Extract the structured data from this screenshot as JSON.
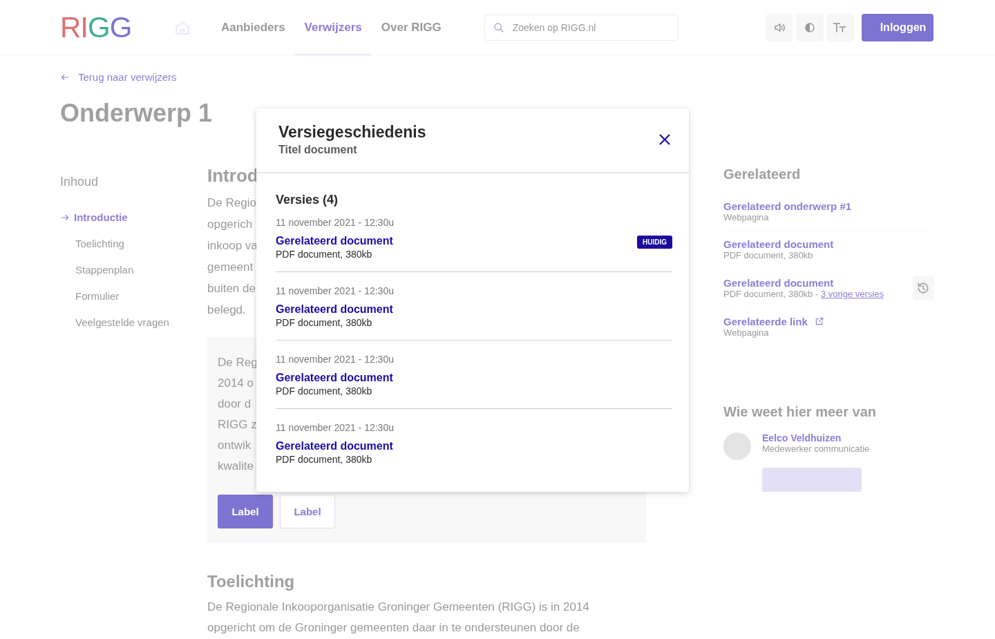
{
  "header": {
    "logo": "RIGG",
    "nav": [
      {
        "label": "Aanbieders",
        "selected": false
      },
      {
        "label": "Verwijzers",
        "selected": true
      },
      {
        "label": "Over RIGG",
        "selected": false
      }
    ],
    "search": {
      "placeholder": "Zoeken op RIGG.nl"
    },
    "login": "Inloggen"
  },
  "back_link": "Terug naar verwijzers",
  "page_title": "Onderwerp 1",
  "sidebar": {
    "heading": "Inhoud",
    "items": [
      {
        "label": "Introductie",
        "selected": true
      },
      {
        "label": "Toelichting",
        "selected": false
      },
      {
        "label": "Stappenplan",
        "selected": false
      },
      {
        "label": "Formulier",
        "selected": false
      },
      {
        "label": "Veelgestelde vragen",
        "selected": false
      }
    ]
  },
  "main": {
    "heading": "Introd",
    "paragraph": [
      "De Regio",
      "opgerich",
      "inkoop va",
      "gemeent",
      "buiten de",
      "belegd."
    ],
    "card": {
      "lines": [
        "De Reg",
        "2014 o",
        "door d",
        "RIGG z",
        "ontwik",
        "kwalite"
      ],
      "buttons": [
        {
          "label": "Label",
          "kind": "primary"
        },
        {
          "label": "Label",
          "kind": "secondary"
        }
      ]
    },
    "section_heading": "Toelichting",
    "section_paragraph": [
      "De Regionale Inkooporganisatie Groninger Gemeenten (RIGG) is in 2014",
      "opgericht om de Groninger gemeenten daar in te ondersteunen door de"
    ]
  },
  "related": {
    "heading": "Gerelateerd",
    "items": [
      {
        "kind": "page",
        "title": "Gerelateerd onderwerp #1",
        "meta": "Webpagina"
      },
      {
        "kind": "document",
        "title": "Gerelateerd document",
        "meta": "PDF document, 380kb"
      },
      {
        "kind": "versions",
        "title": "Gerelateerd document",
        "meta": "PDF document, 380kb - ",
        "versions_link": "3 vorige versies"
      },
      {
        "kind": "external",
        "title": "Gerelateerde link",
        "meta": "Webpagina"
      }
    ]
  },
  "contact": {
    "heading": "Wie weet hier meer van",
    "name": "Eelco Veldhuizen",
    "role": "Medewerker communicatie"
  },
  "modal": {
    "title": "Versiegeschiedenis",
    "subtitle": "Titel document",
    "versions_heading": "Versies (4)",
    "versions": [
      {
        "date": "11 november 2021 - 12:30u",
        "title": "Gerelateerd document",
        "meta": "PDF document, 380kb",
        "badge": "HUIDIG"
      },
      {
        "date": "11 november 2021 - 12:30u",
        "title": "Gerelateerd document",
        "meta": "PDF document, 380kb"
      },
      {
        "date": "11 november 2021 - 12:30u",
        "title": "Gerelateerd document",
        "meta": "PDF document, 380kb"
      },
      {
        "date": "11 november 2021 - 12:30u",
        "title": "Gerelateerd document",
        "meta": "PDF document, 380kb"
      }
    ]
  }
}
